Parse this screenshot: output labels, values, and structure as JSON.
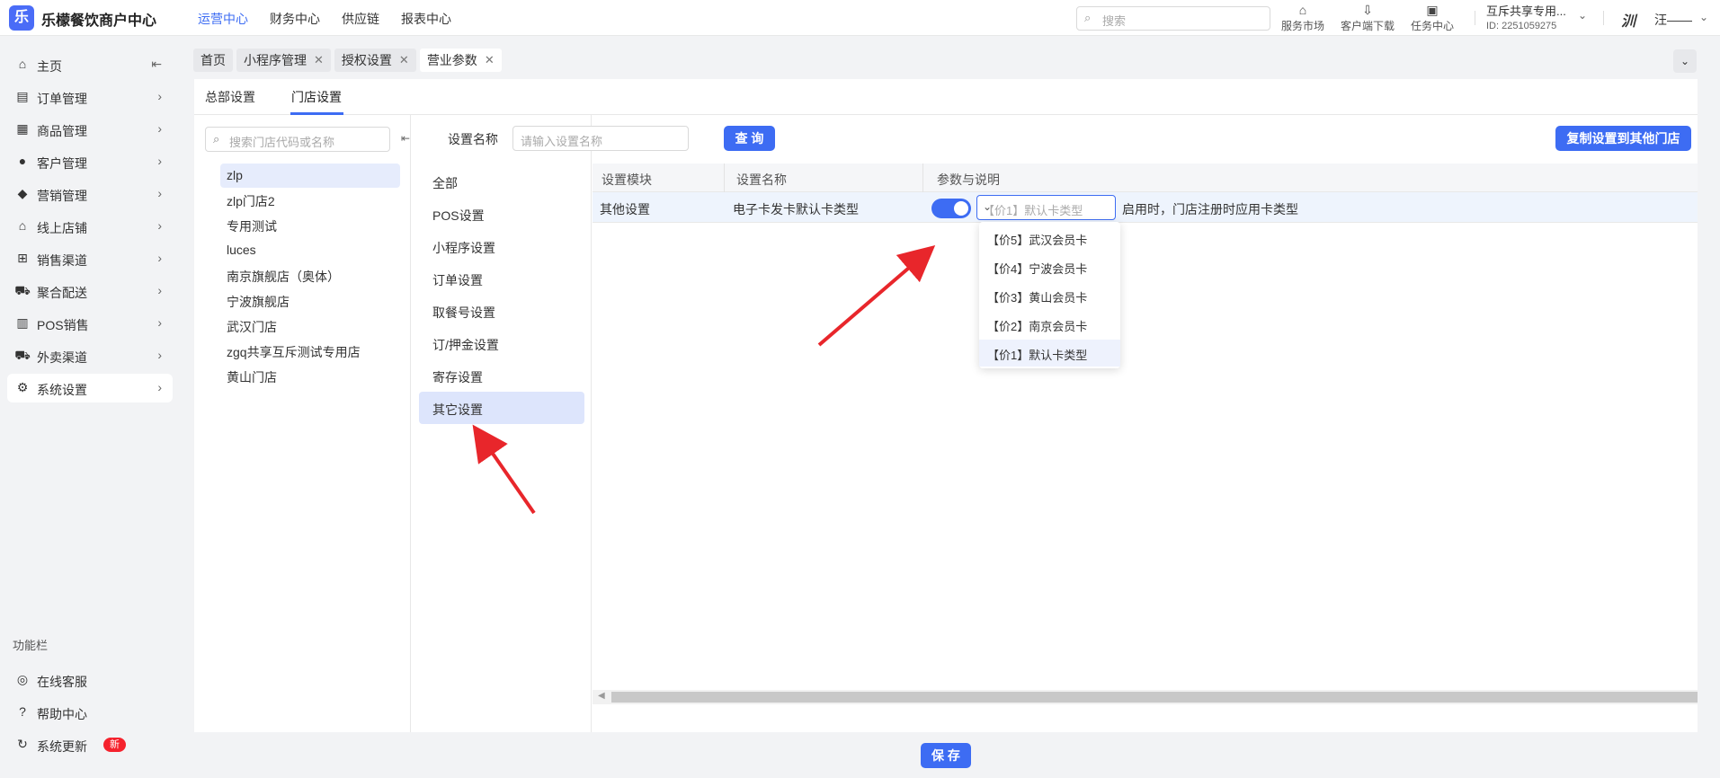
{
  "app": {
    "logo_glyph": "乐",
    "brand": "乐檬餐饮商户中心"
  },
  "topnav": [
    {
      "label": "运营中心",
      "active": true
    },
    {
      "label": "财务中心",
      "active": false
    },
    {
      "label": "供应链",
      "active": false
    },
    {
      "label": "报表中心",
      "active": false
    }
  ],
  "search": {
    "placeholder": "搜索"
  },
  "tools": [
    {
      "label": "服务市场",
      "icon": "store-icon"
    },
    {
      "label": "客户端下载",
      "icon": "download-icon"
    },
    {
      "label": "任务中心",
      "icon": "clipboard-icon"
    }
  ],
  "account": {
    "name": "互斥共享专用...",
    "id": "ID: 2251059275"
  },
  "user": {
    "avatar_text": "汌",
    "name": "汪——"
  },
  "sidebar": {
    "items": [
      {
        "label": "主页",
        "icon": "home-icon",
        "trail": "⇤"
      },
      {
        "label": "订单管理",
        "icon": "order-icon",
        "trail": "›"
      },
      {
        "label": "商品管理",
        "icon": "bag-icon",
        "trail": "›"
      },
      {
        "label": "客户管理",
        "icon": "user-icon",
        "trail": "›"
      },
      {
        "label": "营销管理",
        "icon": "tag-icon",
        "trail": "›"
      },
      {
        "label": "线上店铺",
        "icon": "shop-icon",
        "trail": "›"
      },
      {
        "label": "销售渠道",
        "icon": "bank-icon",
        "trail": "›"
      },
      {
        "label": "聚合配送",
        "icon": "truck-icon",
        "trail": "›"
      },
      {
        "label": "POS销售",
        "icon": "pos-icon",
        "trail": "›"
      },
      {
        "label": "外卖渠道",
        "icon": "delivery-icon",
        "trail": "›"
      },
      {
        "label": "系统设置",
        "icon": "gear-icon",
        "trail": "›"
      }
    ],
    "function_title": "功能栏",
    "bottom": [
      {
        "label": "在线客服",
        "icon": "headset-icon"
      },
      {
        "label": "帮助中心",
        "icon": "help-icon"
      },
      {
        "label": "系统更新",
        "icon": "refresh-icon",
        "badge": "新"
      }
    ]
  },
  "page_tabs": [
    {
      "label": "首页",
      "closable": false
    },
    {
      "label": "小程序管理",
      "closable": true
    },
    {
      "label": "授权设置",
      "closable": true
    },
    {
      "label": "营业参数",
      "closable": true
    }
  ],
  "sub_tabs": [
    {
      "label": "总部设置"
    },
    {
      "label": "门店设置"
    }
  ],
  "store_search": {
    "placeholder": "搜索门店代码或名称"
  },
  "stores": [
    "zlp",
    "zlp门店2",
    "专用测试",
    "luces",
    "南京旗舰店（奥体）",
    "宁波旗舰店",
    "武汉门店",
    "zgq共享互斥测试专用店",
    "黄山门店"
  ],
  "categories": [
    "全部",
    "POS设置",
    "小程序设置",
    "订单设置",
    "取餐号设置",
    "订/押金设置",
    "寄存设置",
    "其它设置"
  ],
  "query": {
    "label": "设置名称",
    "placeholder": "请输入设置名称",
    "button": "查 询",
    "copy_button": "复制设置到其他门店"
  },
  "table": {
    "headers": [
      "设置模块",
      "设置名称",
      "参数与说明"
    ],
    "row": {
      "module": "其他设置",
      "name": "电子卡发卡默认卡类型",
      "toggle_on": true,
      "select_value": "【价1】默认卡类型",
      "description": "启用时，门店注册时应用卡类型"
    }
  },
  "dropdown_options": [
    "【价5】武汉会员卡",
    "【价4】宁波会员卡",
    "【价3】黄山会员卡",
    "【价2】南京会员卡",
    "【价1】默认卡类型"
  ],
  "save_button": "保 存",
  "colors": {
    "accent": "#3d6cf3",
    "arrow": "#e8262b",
    "badge": "#f5222d"
  }
}
